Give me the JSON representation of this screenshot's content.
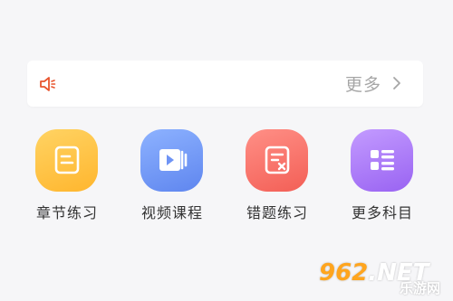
{
  "notice": {
    "icon": "speaker-icon",
    "more_label": "更多",
    "chevron_icon": "chevron-right-icon"
  },
  "tiles": [
    {
      "label": "章节练习",
      "icon": "document-icon",
      "color": "#ffc444"
    },
    {
      "label": "视频课程",
      "icon": "video-play-icon",
      "color": "#7399f7"
    },
    {
      "label": "错题练习",
      "icon": "wrong-question-icon",
      "color": "#f87068"
    },
    {
      "label": "更多科目",
      "icon": "grid-list-icon",
      "color": "#ad7ef8"
    }
  ],
  "watermark": {
    "main_prefix": "",
    "main_number": "962",
    "main_suffix": ".NET",
    "sub": "乐游网"
  },
  "colors": {
    "background": "#f6f6f8",
    "speaker": "#e8552f",
    "muted_text": "#a6a6a6"
  }
}
